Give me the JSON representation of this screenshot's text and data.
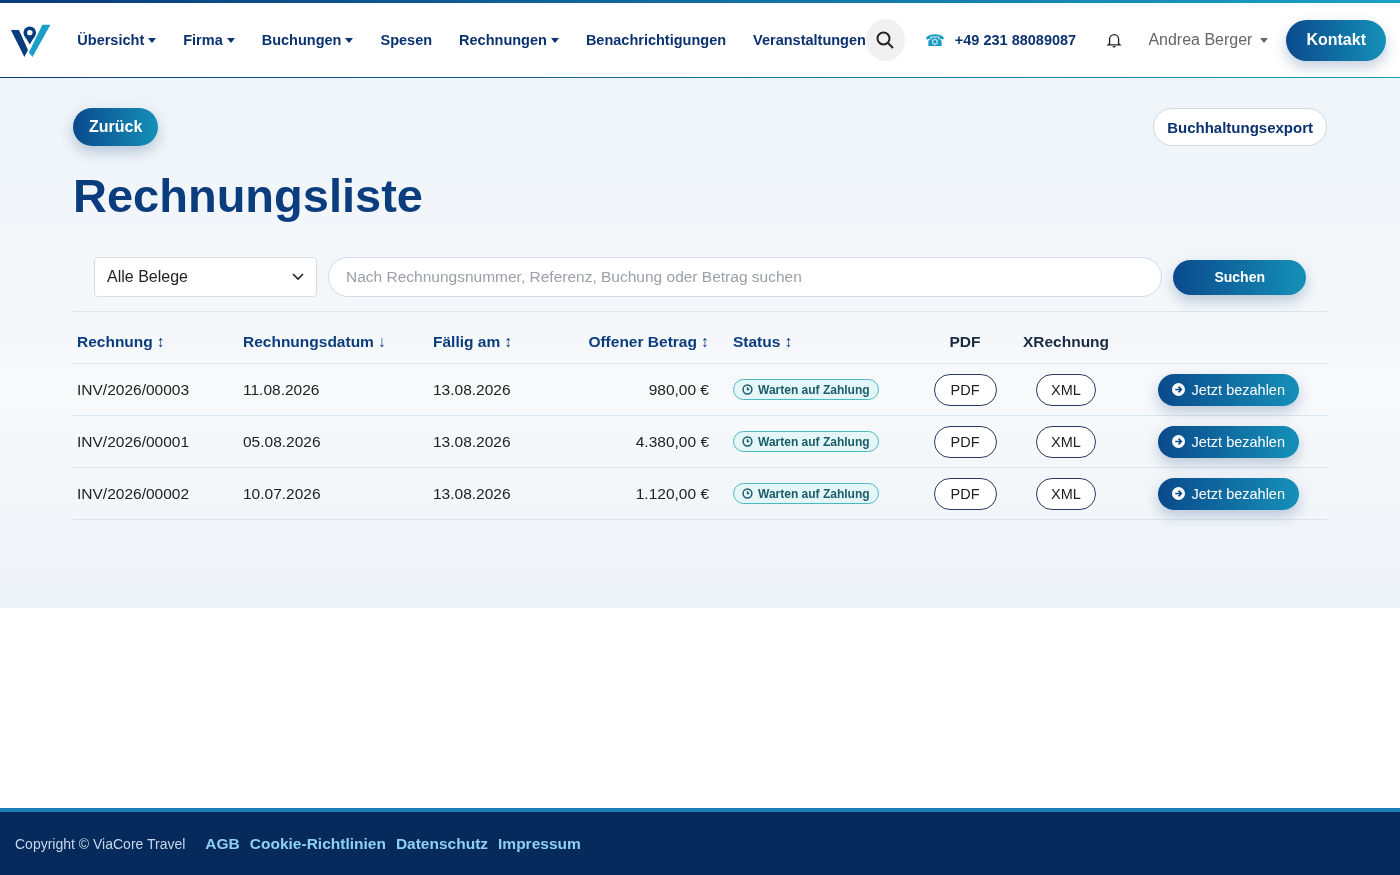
{
  "nav": {
    "items": [
      {
        "label": "Übersicht",
        "dropdown": true
      },
      {
        "label": "Firma",
        "dropdown": true
      },
      {
        "label": "Buchungen",
        "dropdown": true
      },
      {
        "label": "Spesen",
        "dropdown": false
      },
      {
        "label": "Rechnungen",
        "dropdown": true
      },
      {
        "label": "Benachrichtigungen",
        "dropdown": false
      },
      {
        "label": "Veranstaltungen",
        "dropdown": false
      }
    ],
    "phone_icon": "☎",
    "phone": "+49 231 88089087",
    "user": "Andrea Berger",
    "contact_button": "Kontakt"
  },
  "back_button": "Zurück",
  "export_button": "Buchhaltungsexport",
  "title": "Rechnungsliste",
  "filter": {
    "select_value": "Alle Belege",
    "search_placeholder": "Nach Rechnungsnummer, Referenz, Buchung oder Betrag suchen",
    "search_button": "Suchen"
  },
  "table": {
    "columns": [
      {
        "label": "Rechnung",
        "sort": "↕"
      },
      {
        "label": "Rechnungsdatum",
        "sort": "↓"
      },
      {
        "label": "Fällig am",
        "sort": "↕"
      },
      {
        "label": "Offener Betrag",
        "sort": "↕"
      },
      {
        "label": "Status",
        "sort": "↕"
      },
      {
        "label": "PDF"
      },
      {
        "label": "XRechnung"
      }
    ],
    "rows": [
      {
        "invoice": "INV/2026/00003",
        "date": "11.08.2026",
        "due": "13.08.2026",
        "amount": "980,00 €",
        "status": {
          "kind": "waiting",
          "label": "Warten auf Zahlung"
        },
        "pdf": "PDF",
        "xml": "XML",
        "pay": "Jetzt bezahlen"
      },
      {
        "invoice": "INV/2026/00001",
        "date": "05.08.2026",
        "due": "13.08.2026",
        "amount": "4.380,00 €",
        "status": {
          "kind": "waiting",
          "label": "Warten auf Zahlung"
        },
        "pdf": "PDF",
        "xml": "XML",
        "pay": "Jetzt bezahlen"
      },
      {
        "invoice": "INV/2026/00002",
        "date": "10.07.2026",
        "due": "13.08.2026",
        "amount": "1.120,00 €",
        "status": {
          "kind": "waiting",
          "label": "Warten auf Zahlung"
        },
        "pdf": "PDF",
        "xml": "XML",
        "pay": "Jetzt bezahlen"
      }
    ]
  },
  "footer": {
    "copyright": "Copyright © ViaCore Travel",
    "links": [
      "AGB",
      "Cookie-Richtlinien",
      "Datenschutz",
      "Impressum"
    ]
  }
}
